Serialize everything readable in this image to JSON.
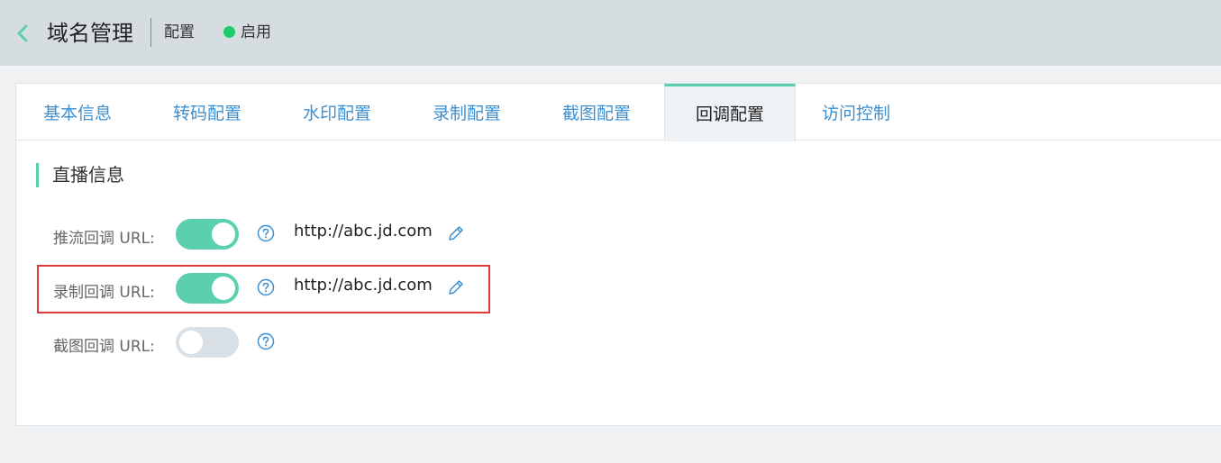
{
  "header": {
    "back_icon": "chevron-left-icon",
    "title": "域名管理",
    "subtitle": "配置",
    "status_text": "启用",
    "status_color": "#1dcb6d"
  },
  "tabs": [
    {
      "label": "基本信息",
      "active": false
    },
    {
      "label": "转码配置",
      "active": false
    },
    {
      "label": "水印配置",
      "active": false
    },
    {
      "label": "录制配置",
      "active": false
    },
    {
      "label": "截图配置",
      "active": false
    },
    {
      "label": "回调配置",
      "active": true
    },
    {
      "label": "访问控制",
      "active": false
    }
  ],
  "section": {
    "title": "直播信息"
  },
  "rows": [
    {
      "label": "推流回调 URL:",
      "enabled": true,
      "url": "http://abc.jd.com",
      "help_icon": "question-circle-icon",
      "edit_icon": "pencil-icon"
    },
    {
      "label": "录制回调 URL:",
      "enabled": true,
      "url": "http://abc.jd.com",
      "help_icon": "question-circle-icon",
      "edit_icon": "pencil-icon"
    },
    {
      "label": "截图回调 URL:",
      "enabled": false,
      "help_icon": "question-circle-icon"
    }
  ],
  "colors": {
    "accent": "#5ccfae",
    "link": "#3d8fd0",
    "highlight": "#e0373b"
  }
}
